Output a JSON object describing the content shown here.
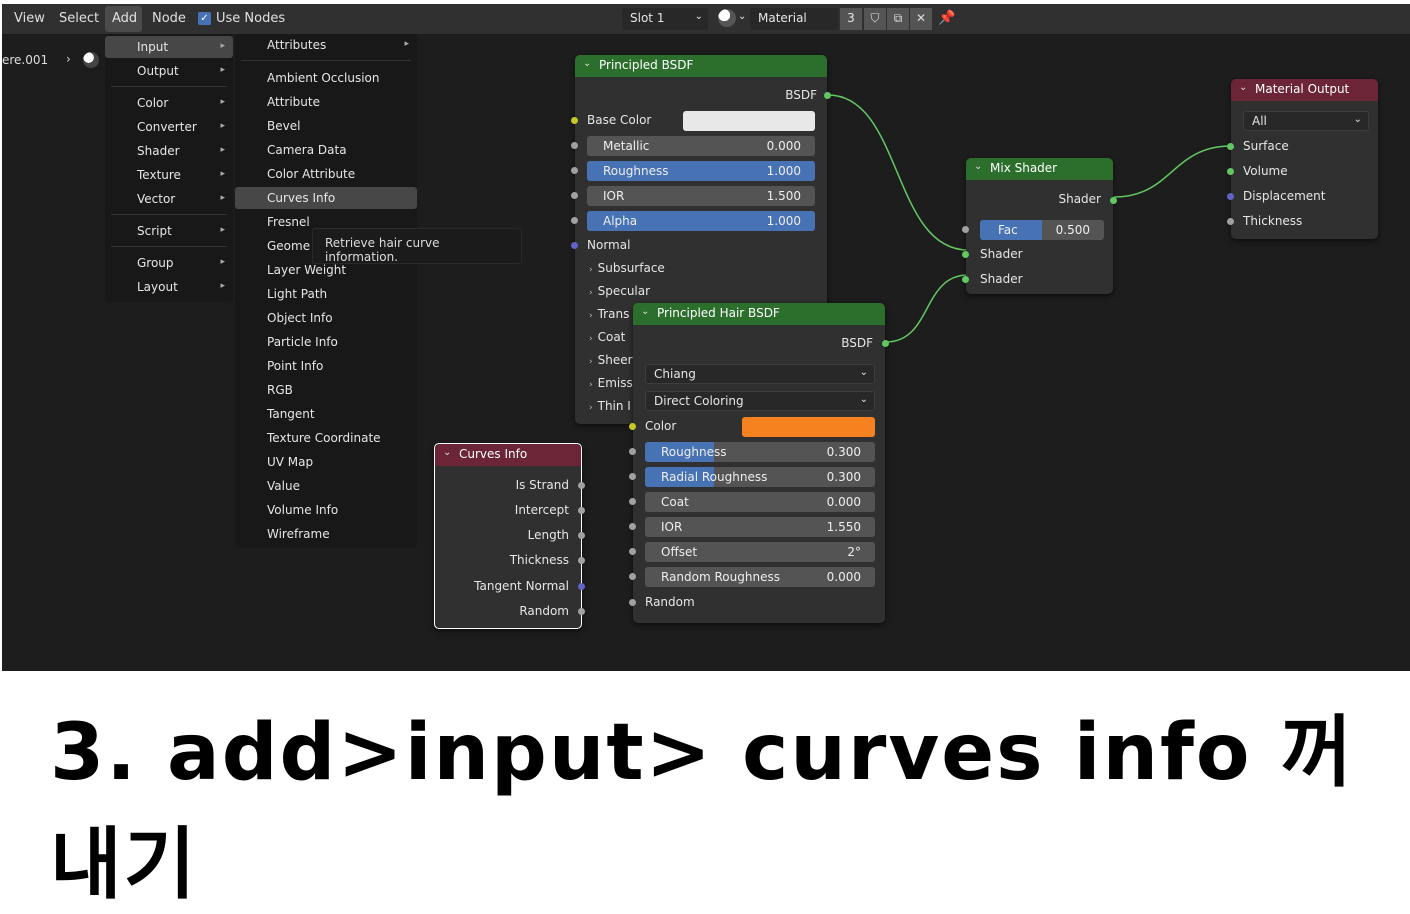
{
  "header": {
    "menus": [
      "View",
      "Select",
      "Add",
      "Node"
    ],
    "use_nodes_label": "Use Nodes",
    "slot": "Slot 1",
    "material_name": "Material",
    "material_users": "3"
  },
  "object_name": "ere.001",
  "add_menu": {
    "items": [
      {
        "label": "Input"
      },
      {
        "label": "Output"
      },
      {
        "label": "Color"
      },
      {
        "label": "Converter"
      },
      {
        "label": "Shader"
      },
      {
        "label": "Texture"
      },
      {
        "label": "Vector"
      },
      {
        "label": "Script"
      },
      {
        "label": "Group"
      },
      {
        "label": "Layout"
      }
    ]
  },
  "input_menu": {
    "items": [
      "Attributes",
      "Ambient Occlusion",
      "Attribute",
      "Bevel",
      "Camera Data",
      "Color Attribute",
      "Curves Info",
      "Fresnel",
      "Geome",
      "Layer Weight",
      "Light Path",
      "Object Info",
      "Particle Info",
      "Point Info",
      "RGB",
      "Tangent",
      "Texture Coordinate",
      "UV Map",
      "Value",
      "Volume Info",
      "Wireframe"
    ]
  },
  "tooltip": "Retrieve hair curve information.",
  "principled_bsdf": {
    "title": "Principled BSDF",
    "output": "BSDF",
    "base_color_label": "Base Color",
    "base_color": "#e8e8e8",
    "fields": [
      {
        "label": "Metallic",
        "value": "0.000",
        "fill": 0
      },
      {
        "label": "Roughness",
        "value": "1.000",
        "fill": 1
      },
      {
        "label": "IOR",
        "value": "1.500",
        "fill": 0
      },
      {
        "label": "Alpha",
        "value": "1.000",
        "fill": 1
      }
    ],
    "normal_label": "Normal",
    "panels": [
      "Subsurface",
      "Specular",
      "Trans",
      "Coat",
      "Sheer",
      "Emiss",
      "Thin I"
    ]
  },
  "hair_bsdf": {
    "title": "Principled Hair BSDF",
    "output": "BSDF",
    "model": "Chiang",
    "parametrization": "Direct Coloring",
    "color_label": "Color",
    "color": "#f5821f",
    "fields": [
      {
        "label": "Roughness",
        "value": "0.300",
        "fill": 0.3
      },
      {
        "label": "Radial Roughness",
        "value": "0.300",
        "fill": 0.3
      },
      {
        "label": "Coat",
        "value": "0.000",
        "fill": 0
      },
      {
        "label": "IOR",
        "value": "1.550",
        "fill": 0
      },
      {
        "label": "Offset",
        "value": "2°",
        "fill": 0
      },
      {
        "label": "Random Roughness",
        "value": "0.000",
        "fill": 0
      }
    ],
    "random_label": "Random"
  },
  "mix_shader": {
    "title": "Mix Shader",
    "output": "Shader",
    "fac_label": "Fac",
    "fac_value": "0.500",
    "input1": "Shader",
    "input2": "Shader"
  },
  "material_output": {
    "title": "Material Output",
    "target": "All",
    "inputs": [
      "Surface",
      "Volume",
      "Displacement",
      "Thickness"
    ]
  },
  "curves_info": {
    "title": "Curves Info",
    "outputs": [
      "Is Strand",
      "Intercept",
      "Length",
      "Thickness",
      "Tangent Normal",
      "Random"
    ]
  },
  "caption": "3. add>input> curves info 꺼내기",
  "colors": {
    "shader_header": "#2c6e2c",
    "input_header": "#6c2536",
    "link": "#63c763",
    "field_fill": "#4772b3"
  }
}
